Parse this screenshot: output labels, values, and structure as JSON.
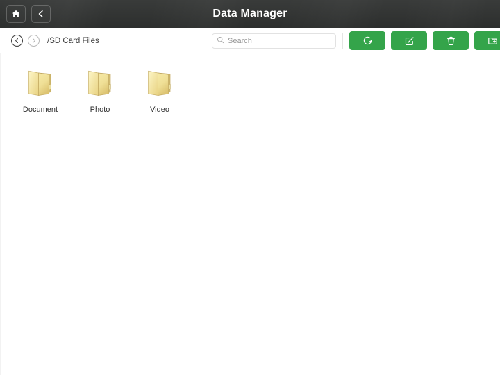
{
  "titlebar": {
    "title": "Data Manager",
    "home_button": {
      "name": "home-button",
      "icon": "home-icon"
    },
    "back_button": {
      "name": "back-button",
      "icon": "chevron-left-icon"
    }
  },
  "toolbar": {
    "nav_back": {
      "label": "Back",
      "icon": "chevron-left-circle-icon"
    },
    "nav_forward": {
      "label": "Forward",
      "icon": "chevron-right-circle-icon"
    },
    "path": "/SD Card Files",
    "search": {
      "placeholder": "Search",
      "value": "",
      "icon": "search-icon"
    },
    "actions": [
      {
        "label": "Refresh",
        "icon": "refresh-icon",
        "name": "refresh-button"
      },
      {
        "label": "Rename",
        "icon": "edit-icon",
        "name": "rename-button"
      },
      {
        "label": "Delete",
        "icon": "trash-icon",
        "name": "delete-button"
      },
      {
        "label": "New Folder",
        "icon": "folder-plus-icon",
        "name": "new-folder-button"
      }
    ],
    "accent_color": "#34a44a"
  },
  "content": {
    "files": [
      {
        "label": "Document",
        "type": "folder"
      },
      {
        "label": "Photo",
        "type": "folder"
      },
      {
        "label": "Video",
        "type": "folder"
      }
    ]
  },
  "colors": {
    "titlebar_bg": "#323433",
    "accent_green": "#34a44a",
    "folder_yellow": "#f2e08c",
    "content_bg": "#ffffff"
  }
}
